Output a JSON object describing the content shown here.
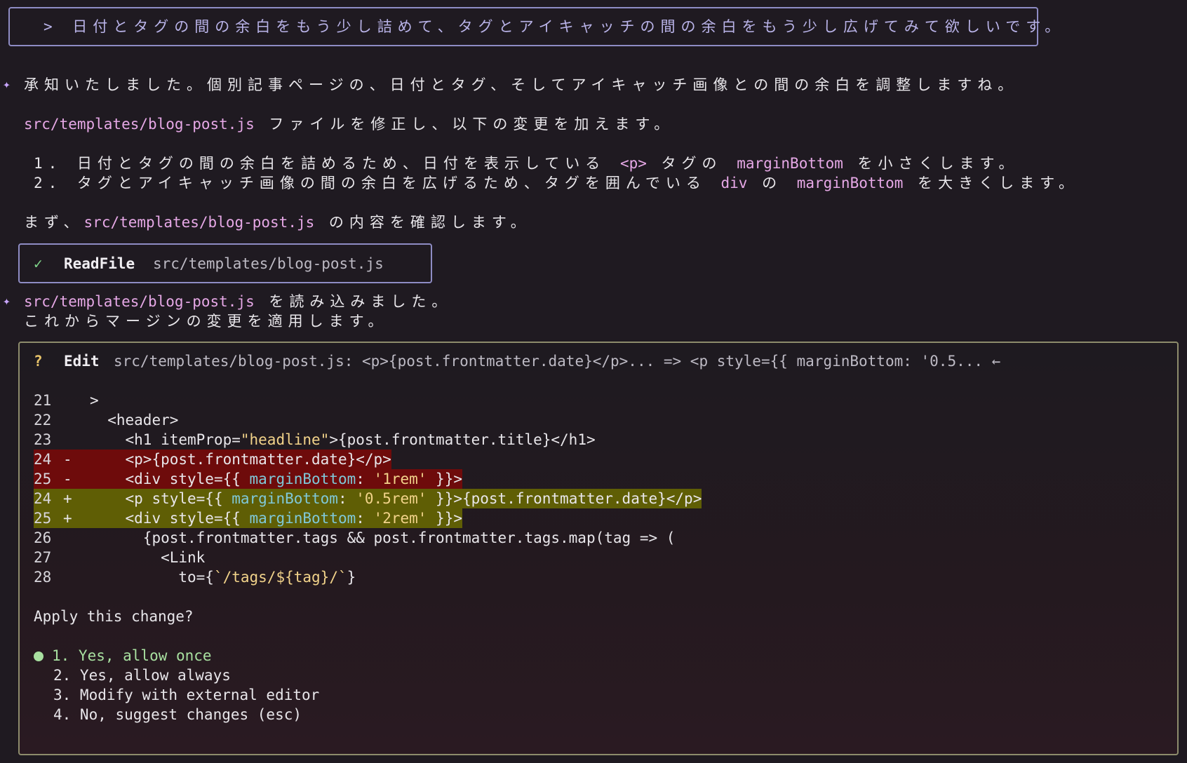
{
  "user_prompt": "> 日付とタグの間の余白をもう少し詰めて、タグとアイキャッチの間の余白をもう少し広げてみて欲しいです。",
  "assistant": {
    "msg1": "承知いたしました。個別記事ページの、日付とタグ、そしてアイキャッチ画像との間の余白を調整しますね。",
    "file_path": "src/templates/blog-post.js",
    "msg2_suffix": " ファイルを修正し、以下の変更を加えます。",
    "step1_a": "1. 日付とタグの間の余白を詰めるため、日付を表示している ",
    "step1_code1": "<p>",
    "step1_b": " タグの ",
    "step1_code2": "marginBottom",
    "step1_c": " を小さくします。",
    "step2_a": "2. タグとアイキャッチ画像の間の余白を広げるため、タグを囲んでいる ",
    "step2_code1": "div",
    "step2_b": " の ",
    "step2_code2": "marginBottom",
    "step2_c": " を大きくします。",
    "msg3_prefix": "まず、",
    "msg3_suffix": " の内容を確認します。",
    "msg4_suffix": " を読み込みました。",
    "msg5": "これからマージンの変更を適用します。"
  },
  "tool": {
    "check_icon": "✓",
    "name": "ReadFile",
    "arg": "src/templates/blog-post.js"
  },
  "edit": {
    "q_icon": "?",
    "title": "Edit",
    "desc": "src/templates/blog-post.js: <p>{post.frontmatter.date}</p>... => <p style={{ marginBottom: '0.5... ←",
    "lines": [
      {
        "num": "21",
        "marker": " ",
        "text": "  >"
      },
      {
        "num": "22",
        "marker": " ",
        "text": "    <header>"
      },
      {
        "num": "23",
        "marker": " ",
        "text_a": "      <h1 itemProp=",
        "text_str": "\"headline\"",
        "text_b": ">{post.frontmatter.title}</h1>"
      },
      {
        "num": "24",
        "marker": "-",
        "text": "      <p>{post.frontmatter.date}</p>"
      },
      {
        "num": "25",
        "marker": "-",
        "text_a": "      <div style={{ ",
        "text_prop": "marginBottom",
        "text_mid": ": ",
        "text_str": "'1rem'",
        "text_b": " }}>"
      },
      {
        "num": "24",
        "marker": "+",
        "text_a": "      <p style={{ ",
        "text_prop": "marginBottom",
        "text_mid": ": ",
        "text_str": "'0.5rem'",
        "text_b": " }}>{post.frontmatter.date}</p>"
      },
      {
        "num": "25",
        "marker": "+",
        "text_a": "      <div style={{ ",
        "text_prop": "marginBottom",
        "text_mid": ": ",
        "text_str": "'2rem'",
        "text_b": " }}>"
      },
      {
        "num": "26",
        "marker": " ",
        "text": "        {post.frontmatter.tags && post.frontmatter.tags.map(tag => ("
      },
      {
        "num": "27",
        "marker": " ",
        "text": "          <Link"
      },
      {
        "num": "28",
        "marker": " ",
        "text_a": "            to={",
        "text_str": "`/tags/${tag}/`",
        "text_b": "}"
      }
    ],
    "question": "Apply this change?",
    "options": [
      "1. Yes, allow once",
      "2. Yes, allow always",
      "3. Modify with external editor",
      "4. No, suggest changes (esc)"
    ]
  }
}
